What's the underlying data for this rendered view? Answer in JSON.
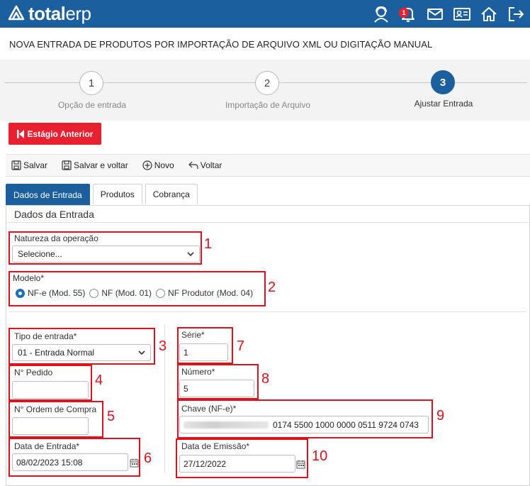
{
  "header": {
    "brand_bold": "total",
    "brand_light": "erp",
    "notification_count": "1",
    "icons": [
      "user-support-icon",
      "bell-icon",
      "mail-icon",
      "id-card-icon",
      "home-icon",
      "logout-icon"
    ],
    "color": "#1b5f9e"
  },
  "page": {
    "title": "NOVA ENTRADA DE PRODUTOS POR IMPORTAÇÃO DE ARQUIVO XML OU DIGITAÇÃO MANUAL"
  },
  "stepper": {
    "steps": [
      {
        "number": "1",
        "label": "Opção de entrada",
        "active": false
      },
      {
        "number": "2",
        "label": "Importação de Arquivo",
        "active": false
      },
      {
        "number": "3",
        "label": "Ajustar Entrada",
        "active": true
      }
    ]
  },
  "actions": {
    "previous_stage": "Estágio Anterior",
    "previous_color": "#e8202f"
  },
  "toolbar": {
    "save": "Salvar",
    "save_back": "Salvar e voltar",
    "new": "Novo",
    "back": "Voltar"
  },
  "tabs": [
    {
      "label": "Dados de Entrada",
      "active": true
    },
    {
      "label": "Produtos",
      "active": false
    },
    {
      "label": "Cobrança",
      "active": false
    }
  ],
  "form": {
    "section_title": "Dados da Entrada",
    "natureza": {
      "label": "Natureza da operação",
      "value": "Selecione..."
    },
    "modelo": {
      "label": "Modelo*",
      "options": [
        {
          "label": "NF-e (Mod. 55)",
          "checked": true
        },
        {
          "label": "NF (Mod. 01)",
          "checked": false
        },
        {
          "label": "NF Produtor (Mod. 04)",
          "checked": false
        }
      ]
    },
    "tipo_entrada": {
      "label": "Tipo de entrada*",
      "value": "01 - Entrada Normal"
    },
    "pedido": {
      "label": "N° Pedido",
      "value": ""
    },
    "ordem_compra": {
      "label": "N° Ordem de Compra",
      "value": ""
    },
    "data_entrada": {
      "label": "Data de Entrada*",
      "value": "08/02/2023 15:08"
    },
    "serie": {
      "label": "Série*",
      "value": "1"
    },
    "numero": {
      "label": "Número*",
      "value": "5"
    },
    "chave": {
      "label": "Chave (NF-e)*",
      "value": "0174 5500 1000 0000 0511 9724 0743"
    },
    "data_emissao": {
      "label": "Data de Emissão*",
      "value": "27/12/2022"
    }
  },
  "annotations": [
    "1",
    "2",
    "3",
    "4",
    "5",
    "6",
    "7",
    "8",
    "9",
    "10"
  ],
  "annotation_color": "#e0101c"
}
